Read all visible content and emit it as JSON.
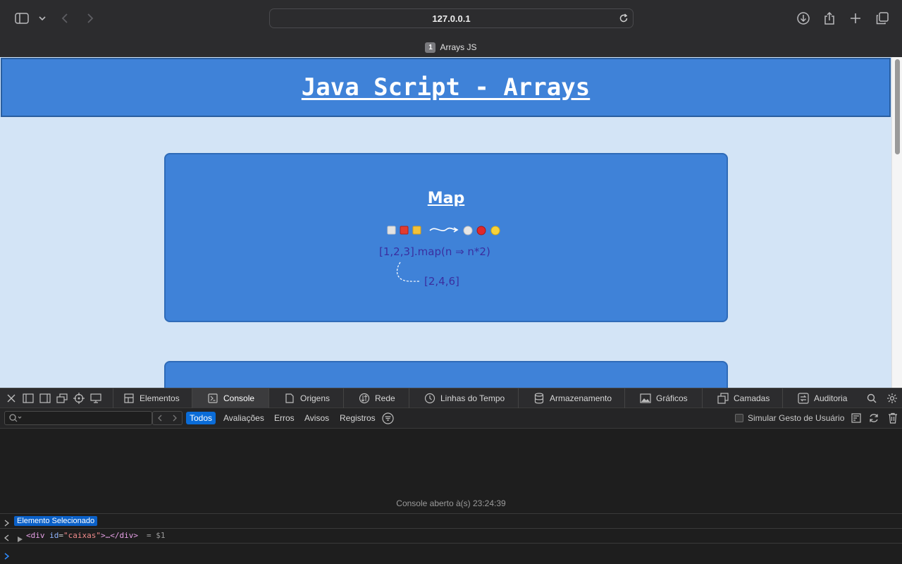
{
  "browser": {
    "url": "127.0.0.1",
    "tab": {
      "number": "1",
      "title": "Arrays JS"
    },
    "icons": [
      "sidebar-icon",
      "chevron-down-icon",
      "back-icon",
      "forward-icon",
      "reload-icon",
      "download-icon",
      "share-icon",
      "plus-icon",
      "tabs-overview-icon"
    ]
  },
  "page": {
    "title": "Java Script - Arrays",
    "cards": [
      {
        "title": "Map",
        "illustration": {
          "emoji_in": [
            "⬜",
            "🟥",
            "🟨"
          ],
          "emoji_out": [
            "⚪",
            "🔴",
            "🟡"
          ],
          "code_line": "[1,2,3].map(n ⇒ n*2)",
          "result": "[2,4,6]"
        }
      }
    ]
  },
  "devtools": {
    "tabs": [
      {
        "label": "Elementos",
        "icon": "elements-icon"
      },
      {
        "label": "Console",
        "icon": "console-icon",
        "active": true
      },
      {
        "label": "Origens",
        "icon": "sources-icon"
      },
      {
        "label": "Rede",
        "icon": "network-icon"
      },
      {
        "label": "Linhas do Tempo",
        "icon": "clock-icon"
      },
      {
        "label": "Armazenamento",
        "icon": "storage-icon"
      },
      {
        "label": "Gráficos",
        "icon": "graphics-icon"
      },
      {
        "label": "Camadas",
        "icon": "layers-icon"
      },
      {
        "label": "Auditoria",
        "icon": "audit-icon"
      }
    ],
    "filters": [
      {
        "label": "Todos",
        "active": true
      },
      {
        "label": "Avaliações"
      },
      {
        "label": "Erros"
      },
      {
        "label": "Avisos"
      },
      {
        "label": "Registros"
      }
    ],
    "simulate_label": "Simular Gesto de Usuário",
    "console": {
      "opened_message": "Console aberto à(s) 23:24:39",
      "selected_badge": "Elemento Selecionado",
      "element_tag_open": "<div",
      "element_attr": "id",
      "element_value": "\"caixas\"",
      "element_rest": ">…</div>",
      "element_ref": "= $1"
    }
  },
  "colors": {
    "header_blue": "#3f82d8",
    "page_bg": "#d3e4f6",
    "devtools_active": "#0a6cd8"
  }
}
